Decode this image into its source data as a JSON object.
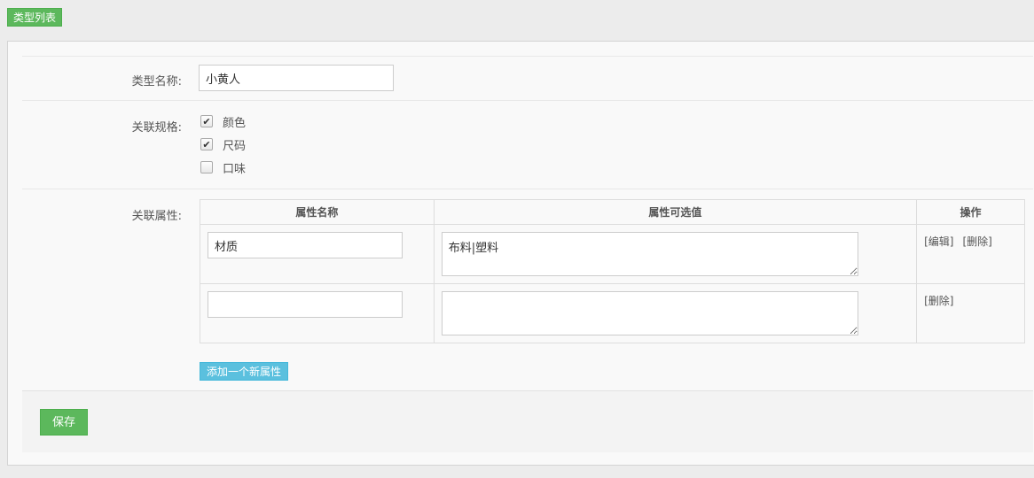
{
  "header": {
    "type_list_button": "类型列表"
  },
  "form": {
    "type_name": {
      "label": "类型名称:",
      "value": "小黄人"
    },
    "specs": {
      "label": "关联规格:",
      "items": [
        {
          "label": "颜色",
          "checked": true
        },
        {
          "label": "尺码",
          "checked": true
        },
        {
          "label": "口味",
          "checked": false
        }
      ]
    },
    "attributes": {
      "label": "关联属性:",
      "columns": [
        "属性名称",
        "属性可选值",
        "操作"
      ],
      "rows": [
        {
          "name": "材质",
          "values": "布料|塑料",
          "ops": [
            "[编辑]",
            "[删除]"
          ]
        },
        {
          "name": "",
          "values": "",
          "ops": [
            "[删除]"
          ]
        }
      ],
      "add_button": "添加一个新属性"
    },
    "save_button": "保存"
  },
  "icons": {
    "checkmark": "check-icon"
  },
  "colors": {
    "success": "#5cb85c",
    "info": "#5bc0de"
  }
}
